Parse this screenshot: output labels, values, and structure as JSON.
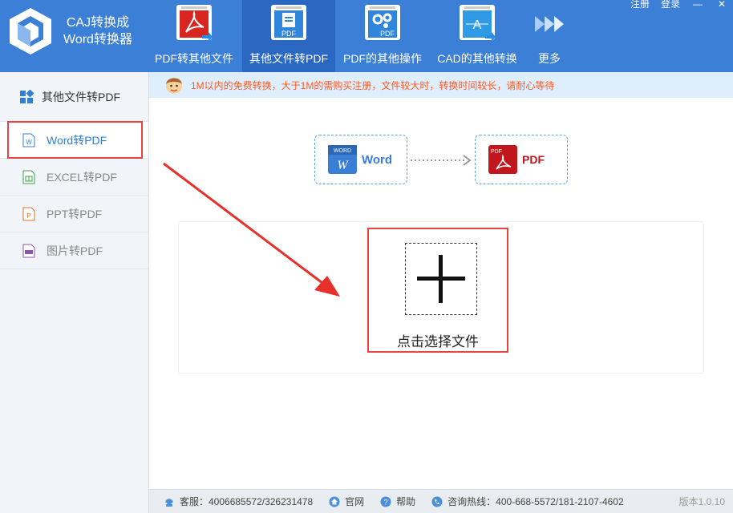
{
  "app": {
    "title_line1": "CAJ转换成",
    "title_line2": "Word转换器"
  },
  "window": {
    "register": "注册",
    "login": "登录",
    "minimize": "—",
    "close": "✕"
  },
  "nav": [
    {
      "label": "PDF转其他文件",
      "icon": "pdf-icon"
    },
    {
      "label": "其他文件转PDF",
      "icon": "doc-to-pdf-icon",
      "active": true
    },
    {
      "label": "PDF的其他操作",
      "icon": "pdf-settings-icon"
    },
    {
      "label": "CAD的其他转换",
      "icon": "cad-icon"
    },
    {
      "label": "更多",
      "icon": "more-arrows-icon"
    }
  ],
  "sidebar": {
    "header": "其他文件转PDF",
    "items": [
      {
        "label": "Word转PDF",
        "active": true
      },
      {
        "label": "EXCEL转PDF"
      },
      {
        "label": "PPT转PDF"
      },
      {
        "label": "图片转PDF"
      }
    ]
  },
  "notice": {
    "text": "1M以内的免费转换，大于1M的需购买注册，文件较大时，转换时间较长，请耐心等待"
  },
  "flow": {
    "from_label": "Word",
    "from_badge": "WORD",
    "to_label": "PDF",
    "to_badge": "PDF"
  },
  "drop": {
    "choose_label": "点击选择文件"
  },
  "footer": {
    "service": "客服：4006685572/326231478",
    "website": "官网",
    "help": "帮助",
    "hotline": "咨询热线：400-668-5572/181-2107-4602",
    "version": "版本1.0.10"
  },
  "colors": {
    "header": "#3b7fd6",
    "accent": "#2f7fd3",
    "highlight": "#e84242",
    "notice": "#ff5a1f"
  }
}
